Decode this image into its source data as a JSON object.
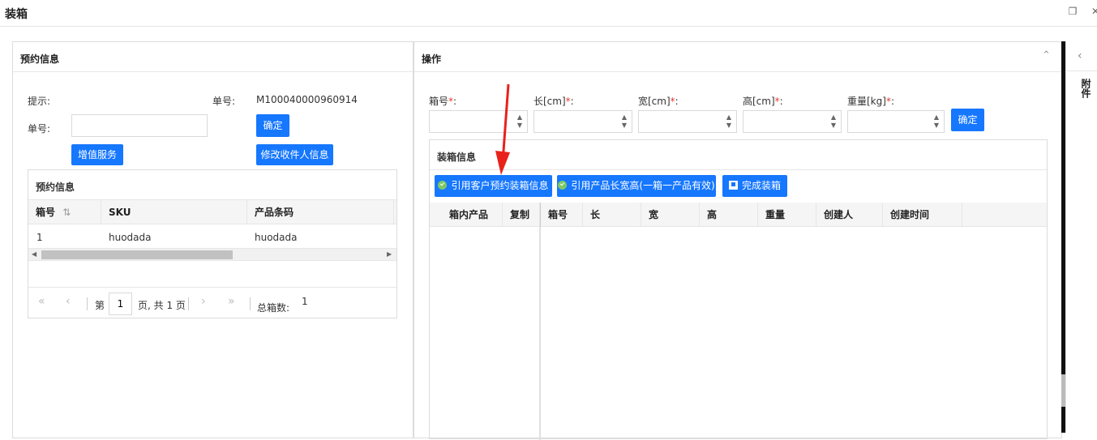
{
  "window": {
    "title": "装箱"
  },
  "left": {
    "header": "预约信息",
    "hint_label": "提示:",
    "order_label_top": "单号:",
    "order_value_top": "M100040000960914",
    "order_label": "单号:",
    "order_input_value": "",
    "confirm": "确定",
    "value_added": "增值服务",
    "modify_receiver": "修改收件人信息",
    "grid": {
      "title": "预约信息",
      "columns": [
        "箱号",
        "SKU",
        "产品条码"
      ],
      "rows": [
        [
          "1",
          "huodada",
          "huodada"
        ]
      ]
    },
    "pager": {
      "page_prefix": "第",
      "page_value": "1",
      "page_suffix": "页, 共 1 页",
      "total_label": "总箱数:",
      "total_value": "1"
    }
  },
  "right": {
    "header": "操作",
    "fields": {
      "box_no": "箱号",
      "length": "长[cm]",
      "width": "宽[cm]",
      "height": "高[cm]",
      "weight": "重量[kg]",
      "required_mark": "*",
      "colon": ":"
    },
    "confirm": "确定",
    "packing": {
      "title": "装箱信息",
      "btn_use_reservation": "引用客户预约装箱信息",
      "btn_use_dimensions": "引用产品长宽高(一箱一产品有效)",
      "btn_finish": "完成装箱",
      "left_columns": [
        "箱内产品",
        "复制"
      ],
      "right_columns": [
        "箱号",
        "长",
        "宽",
        "高",
        "重量",
        "创建人",
        "创建时间"
      ]
    }
  },
  "side_tab": {
    "label": "附件"
  },
  "colors": {
    "accent": "#1677ff",
    "annotation_arrow": "#e8221b",
    "required": "#e53935"
  }
}
